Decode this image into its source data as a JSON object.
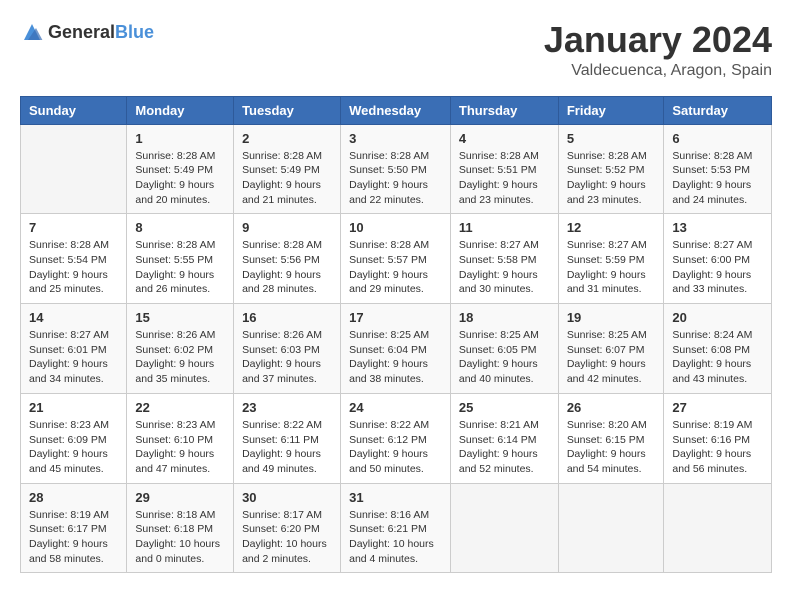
{
  "header": {
    "logo_general": "General",
    "logo_blue": "Blue",
    "month_title": "January 2024",
    "location": "Valdecuenca, Aragon, Spain"
  },
  "weekdays": [
    "Sunday",
    "Monday",
    "Tuesday",
    "Wednesday",
    "Thursday",
    "Friday",
    "Saturday"
  ],
  "weeks": [
    [
      {
        "day": "",
        "sunrise": "",
        "sunset": "",
        "daylight": ""
      },
      {
        "day": "1",
        "sunrise": "Sunrise: 8:28 AM",
        "sunset": "Sunset: 5:49 PM",
        "daylight": "Daylight: 9 hours and 20 minutes."
      },
      {
        "day": "2",
        "sunrise": "Sunrise: 8:28 AM",
        "sunset": "Sunset: 5:49 PM",
        "daylight": "Daylight: 9 hours and 21 minutes."
      },
      {
        "day": "3",
        "sunrise": "Sunrise: 8:28 AM",
        "sunset": "Sunset: 5:50 PM",
        "daylight": "Daylight: 9 hours and 22 minutes."
      },
      {
        "day": "4",
        "sunrise": "Sunrise: 8:28 AM",
        "sunset": "Sunset: 5:51 PM",
        "daylight": "Daylight: 9 hours and 23 minutes."
      },
      {
        "day": "5",
        "sunrise": "Sunrise: 8:28 AM",
        "sunset": "Sunset: 5:52 PM",
        "daylight": "Daylight: 9 hours and 23 minutes."
      },
      {
        "day": "6",
        "sunrise": "Sunrise: 8:28 AM",
        "sunset": "Sunset: 5:53 PM",
        "daylight": "Daylight: 9 hours and 24 minutes."
      }
    ],
    [
      {
        "day": "7",
        "sunrise": "Sunrise: 8:28 AM",
        "sunset": "Sunset: 5:54 PM",
        "daylight": "Daylight: 9 hours and 25 minutes."
      },
      {
        "day": "8",
        "sunrise": "Sunrise: 8:28 AM",
        "sunset": "Sunset: 5:55 PM",
        "daylight": "Daylight: 9 hours and 26 minutes."
      },
      {
        "day": "9",
        "sunrise": "Sunrise: 8:28 AM",
        "sunset": "Sunset: 5:56 PM",
        "daylight": "Daylight: 9 hours and 28 minutes."
      },
      {
        "day": "10",
        "sunrise": "Sunrise: 8:28 AM",
        "sunset": "Sunset: 5:57 PM",
        "daylight": "Daylight: 9 hours and 29 minutes."
      },
      {
        "day": "11",
        "sunrise": "Sunrise: 8:27 AM",
        "sunset": "Sunset: 5:58 PM",
        "daylight": "Daylight: 9 hours and 30 minutes."
      },
      {
        "day": "12",
        "sunrise": "Sunrise: 8:27 AM",
        "sunset": "Sunset: 5:59 PM",
        "daylight": "Daylight: 9 hours and 31 minutes."
      },
      {
        "day": "13",
        "sunrise": "Sunrise: 8:27 AM",
        "sunset": "Sunset: 6:00 PM",
        "daylight": "Daylight: 9 hours and 33 minutes."
      }
    ],
    [
      {
        "day": "14",
        "sunrise": "Sunrise: 8:27 AM",
        "sunset": "Sunset: 6:01 PM",
        "daylight": "Daylight: 9 hours and 34 minutes."
      },
      {
        "day": "15",
        "sunrise": "Sunrise: 8:26 AM",
        "sunset": "Sunset: 6:02 PM",
        "daylight": "Daylight: 9 hours and 35 minutes."
      },
      {
        "day": "16",
        "sunrise": "Sunrise: 8:26 AM",
        "sunset": "Sunset: 6:03 PM",
        "daylight": "Daylight: 9 hours and 37 minutes."
      },
      {
        "day": "17",
        "sunrise": "Sunrise: 8:25 AM",
        "sunset": "Sunset: 6:04 PM",
        "daylight": "Daylight: 9 hours and 38 minutes."
      },
      {
        "day": "18",
        "sunrise": "Sunrise: 8:25 AM",
        "sunset": "Sunset: 6:05 PM",
        "daylight": "Daylight: 9 hours and 40 minutes."
      },
      {
        "day": "19",
        "sunrise": "Sunrise: 8:25 AM",
        "sunset": "Sunset: 6:07 PM",
        "daylight": "Daylight: 9 hours and 42 minutes."
      },
      {
        "day": "20",
        "sunrise": "Sunrise: 8:24 AM",
        "sunset": "Sunset: 6:08 PM",
        "daylight": "Daylight: 9 hours and 43 minutes."
      }
    ],
    [
      {
        "day": "21",
        "sunrise": "Sunrise: 8:23 AM",
        "sunset": "Sunset: 6:09 PM",
        "daylight": "Daylight: 9 hours and 45 minutes."
      },
      {
        "day": "22",
        "sunrise": "Sunrise: 8:23 AM",
        "sunset": "Sunset: 6:10 PM",
        "daylight": "Daylight: 9 hours and 47 minutes."
      },
      {
        "day": "23",
        "sunrise": "Sunrise: 8:22 AM",
        "sunset": "Sunset: 6:11 PM",
        "daylight": "Daylight: 9 hours and 49 minutes."
      },
      {
        "day": "24",
        "sunrise": "Sunrise: 8:22 AM",
        "sunset": "Sunset: 6:12 PM",
        "daylight": "Daylight: 9 hours and 50 minutes."
      },
      {
        "day": "25",
        "sunrise": "Sunrise: 8:21 AM",
        "sunset": "Sunset: 6:14 PM",
        "daylight": "Daylight: 9 hours and 52 minutes."
      },
      {
        "day": "26",
        "sunrise": "Sunrise: 8:20 AM",
        "sunset": "Sunset: 6:15 PM",
        "daylight": "Daylight: 9 hours and 54 minutes."
      },
      {
        "day": "27",
        "sunrise": "Sunrise: 8:19 AM",
        "sunset": "Sunset: 6:16 PM",
        "daylight": "Daylight: 9 hours and 56 minutes."
      }
    ],
    [
      {
        "day": "28",
        "sunrise": "Sunrise: 8:19 AM",
        "sunset": "Sunset: 6:17 PM",
        "daylight": "Daylight: 9 hours and 58 minutes."
      },
      {
        "day": "29",
        "sunrise": "Sunrise: 8:18 AM",
        "sunset": "Sunset: 6:18 PM",
        "daylight": "Daylight: 10 hours and 0 minutes."
      },
      {
        "day": "30",
        "sunrise": "Sunrise: 8:17 AM",
        "sunset": "Sunset: 6:20 PM",
        "daylight": "Daylight: 10 hours and 2 minutes."
      },
      {
        "day": "31",
        "sunrise": "Sunrise: 8:16 AM",
        "sunset": "Sunset: 6:21 PM",
        "daylight": "Daylight: 10 hours and 4 minutes."
      },
      {
        "day": "",
        "sunrise": "",
        "sunset": "",
        "daylight": ""
      },
      {
        "day": "",
        "sunrise": "",
        "sunset": "",
        "daylight": ""
      },
      {
        "day": "",
        "sunrise": "",
        "sunset": "",
        "daylight": ""
      }
    ]
  ]
}
